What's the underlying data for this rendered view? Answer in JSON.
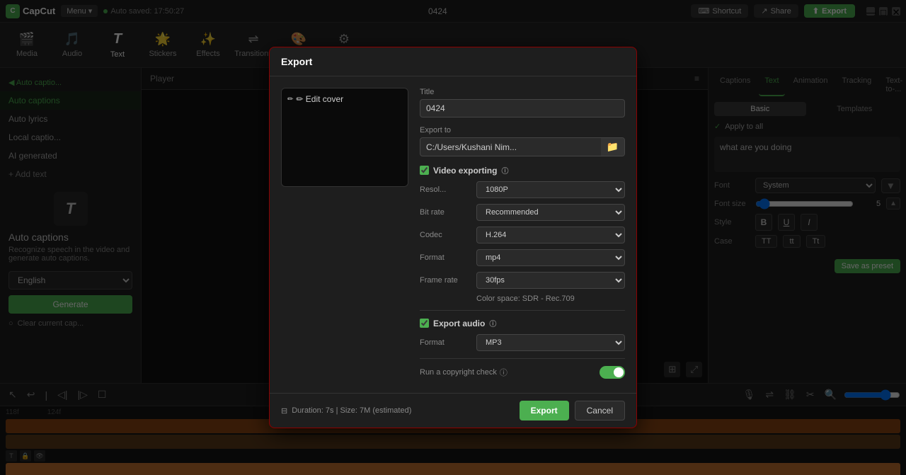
{
  "app": {
    "name": "CapCut",
    "logo_text": "C",
    "menu_label": "Menu ▾",
    "autosave_text": "Auto saved: 17:50:27",
    "center_title": "0424",
    "shortcut_label": "Shortcut",
    "share_label": "Share",
    "export_label": "Export"
  },
  "toolbar": {
    "items": [
      {
        "id": "media",
        "label": "Media",
        "icon": "🎬"
      },
      {
        "id": "audio",
        "label": "Audio",
        "icon": "🎵"
      },
      {
        "id": "text",
        "label": "Text",
        "icon": "T",
        "active": true
      },
      {
        "id": "stickers",
        "label": "Stickers",
        "icon": "🌟"
      },
      {
        "id": "effects",
        "label": "Effects",
        "icon": "✨"
      },
      {
        "id": "transitions",
        "label": "Transitions",
        "icon": "⇌"
      },
      {
        "id": "filters",
        "label": "Filters",
        "icon": "🎨"
      },
      {
        "id": "adjustment",
        "label": "Adjustment",
        "icon": "⚙"
      }
    ]
  },
  "left_panel": {
    "breadcrumb": "◀ Auto captio...",
    "items": [
      {
        "id": "auto-captions",
        "label": "Auto captions",
        "active": true
      },
      {
        "id": "auto-lyrics",
        "label": "Auto lyrics"
      },
      {
        "id": "local-captions",
        "label": "Local captio..."
      },
      {
        "id": "ai-generated",
        "label": "AI generated"
      }
    ],
    "add_text": "+ Add text"
  },
  "auto_captions": {
    "icon": "T",
    "title": "Auto captions",
    "description": "Recognize speech in the video and generate auto captions.",
    "language_label": "English",
    "generate_label": "Generate",
    "clear_label": "Clear current cap..."
  },
  "player": {
    "title": "Player"
  },
  "right_panel": {
    "tabs": [
      "Captions",
      "Text",
      "Animation",
      "Tracking",
      "Text-to-..."
    ],
    "active_tab": "Text",
    "subtabs": [
      "Basic",
      "Templates"
    ],
    "active_subtab": "Basic",
    "apply_to_all": "Apply to all",
    "text_content": "what are you doing",
    "font_label": "Font",
    "font_value": "System",
    "font_size_label": "Font size",
    "font_size_value": "5",
    "style_label": "Style",
    "style_buttons": [
      "B",
      "U",
      "I"
    ],
    "case_label": "Case",
    "case_buttons": [
      "TT",
      "tt",
      "Tt"
    ],
    "save_preset_label": "Save as preset"
  },
  "modal": {
    "title": "Export",
    "edit_cover_label": "✏ Edit cover",
    "title_label": "Title",
    "title_value": "0424",
    "export_to_label": "Export to",
    "export_path": "C:/Users/Kushani Nim...",
    "video_exporting_label": "Video exporting",
    "video_exporting_checked": true,
    "resolution_label": "Resol...",
    "resolution_value": "1080P",
    "bitrate_label": "Bit rate",
    "bitrate_value": "Recommended",
    "codec_label": "Codec",
    "codec_value": "H.264",
    "format_label": "Format",
    "format_value": "mp4",
    "frame_rate_label": "Frame rate",
    "frame_rate_value": "30fps",
    "color_space": "Color space: SDR - Rec.709",
    "export_audio_label": "Export audio",
    "export_audio_checked": true,
    "audio_format_label": "Format",
    "audio_format_value": "MP3",
    "copyright_label": "Run a copyright check",
    "copyright_enabled": true,
    "duration": "Duration: 7s | Size: 7M (estimated)",
    "export_btn": "Export",
    "cancel_btn": "Cancel"
  },
  "timeline": {
    "time_markers": [
      "118f",
      "124f"
    ]
  }
}
